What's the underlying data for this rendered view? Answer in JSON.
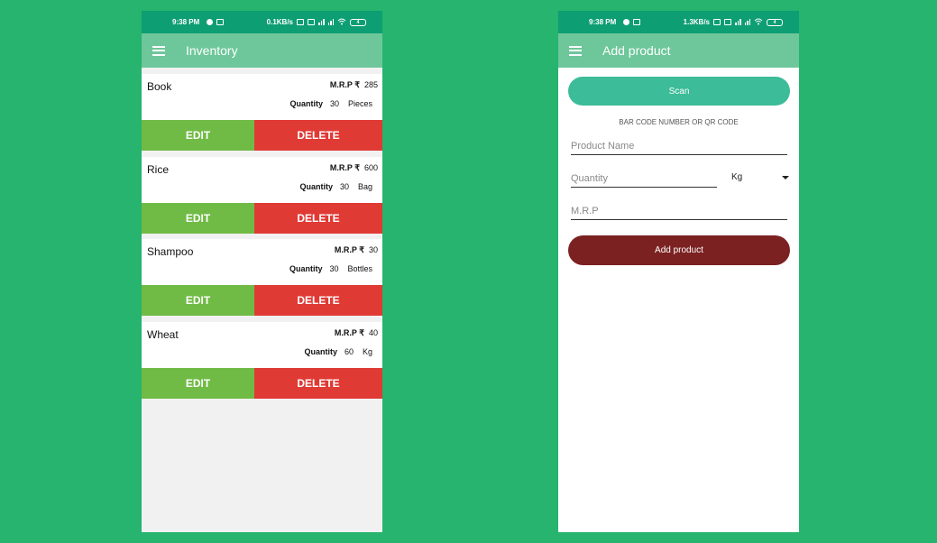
{
  "left_screen": {
    "status": {
      "time": "9:38 PM",
      "speed": "0.1KB/s",
      "battery": "4"
    },
    "appbar": {
      "title": "Inventory",
      "menu_icon": "hamburger-menu-icon"
    },
    "mrp_label": "M.R.P ₹",
    "quantity_label": "Quantity",
    "edit_label": "EDIT",
    "delete_label": "DELETE",
    "colors": {
      "edit": "#70bb45",
      "delete": "#e03a35",
      "appbar": "#6dc79a",
      "statusbar": "#0e9e74"
    },
    "products": [
      {
        "name": "Book",
        "mrp": "285",
        "quantity": "30",
        "unit": "Pieces"
      },
      {
        "name": "Rice",
        "mrp": "600",
        "quantity": "30",
        "unit": "Bag"
      },
      {
        "name": "Shampoo",
        "mrp": "30",
        "quantity": "30",
        "unit": "Bottles"
      },
      {
        "name": "Wheat",
        "mrp": "40",
        "quantity": "60",
        "unit": "Kg"
      }
    ]
  },
  "right_screen": {
    "status": {
      "time": "9:38 PM",
      "speed": "1.3KB/s",
      "battery": "4"
    },
    "appbar": {
      "title": "Add product",
      "menu_icon": "hamburger-menu-icon"
    },
    "scan_label": "Scan",
    "code_label": "BAR CODE NUMBER OR QR CODE",
    "product_name_placeholder": "Product Name",
    "quantity_placeholder": "Quantity",
    "unit_selected": "Kg",
    "mrp_placeholder": "M.R.P",
    "add_label": "Add product",
    "colors": {
      "scan": "#3cbc98",
      "add": "#7b2121"
    }
  }
}
